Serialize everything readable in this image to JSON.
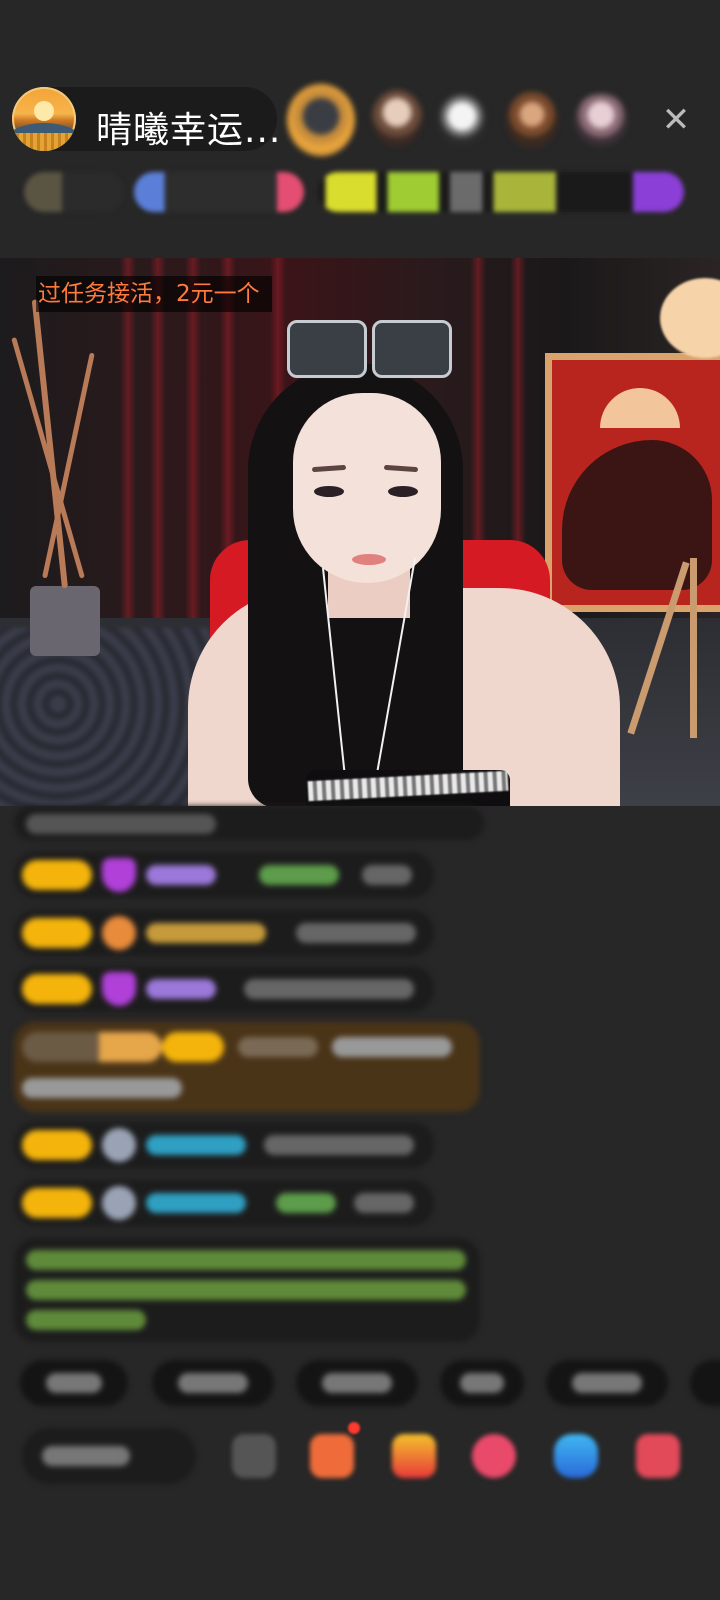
{
  "header": {
    "host_name": "晴曦幸运...",
    "close_icon": "close-icon"
  },
  "video": {
    "overlay_text": "过任务接活，2元一个"
  },
  "colors": {
    "overlay_text": "#ff7a3d",
    "level_badge": "#f4b40c",
    "highlight_bubble": "#4a3418",
    "name_green": "#7fd35a",
    "name_cyan": "#33b6d6",
    "name_purple": "#b07de0"
  }
}
